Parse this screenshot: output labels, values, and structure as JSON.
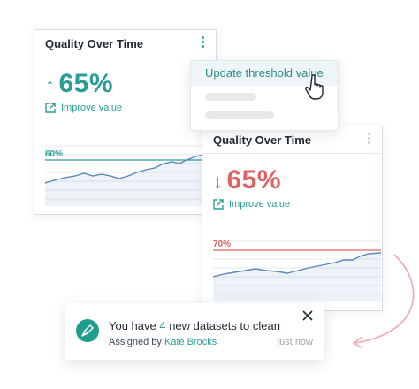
{
  "colors": {
    "teal": "#2a9d97",
    "red": "#e06363",
    "gridline": "#e3e7eb",
    "sparkline": "#5b86b8"
  },
  "card1": {
    "title": "Quality Over Time",
    "trend": "up",
    "value": "65%",
    "improve_label": "Improve value",
    "threshold_label": "60%",
    "menu_icon": "kebab-icon"
  },
  "card2": {
    "title": "Quality Over Time",
    "trend": "down",
    "value": "65%",
    "improve_label": "Improve value",
    "threshold_label": "70%",
    "menu_icon": "kebab-icon"
  },
  "menu": {
    "items": [
      {
        "label": "Update threshold value"
      }
    ]
  },
  "toast": {
    "prefix": "You have ",
    "count": "4",
    "suffix": " new datasets to clean",
    "assigned_prefix": "Assigned by ",
    "assigned_user": "Kate Brocks",
    "time": "just now",
    "icon": "broom-icon"
  }
}
